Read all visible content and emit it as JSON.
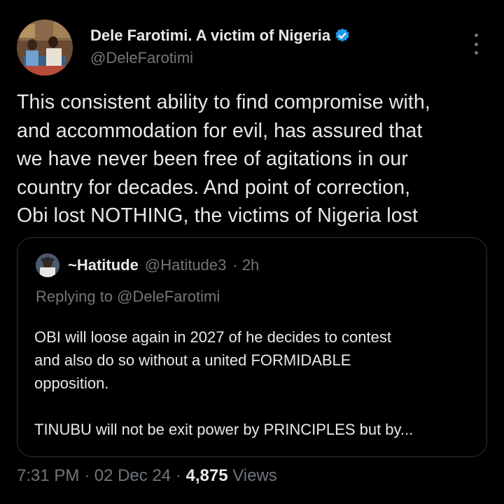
{
  "author": {
    "display_name": "Dele Farotimi. A victim of Nigeria",
    "handle": "@DeleFarotimi",
    "verified_color": "#1d9bf0"
  },
  "tweet": {
    "text_lines": [
      "This consistent ability to find compromise with,",
      "and accommodation for evil, has assured that",
      "we have never been free of agitations in our",
      "country for decades. And point of correction,",
      "Obi lost NOTHING, the victims of Nigeria lost"
    ]
  },
  "quote": {
    "display_name": "~Hatitude",
    "handle": "@Hatitude3",
    "time": "· 2h",
    "replying_to": "Replying to @DeleFarotimi",
    "para1_lines": [
      "OBI will loose again in 2027 of he decides to contest",
      "and also do so without a united FORMIDABLE",
      "opposition."
    ],
    "para2": "TINUBU will not be exit power by PRINCIPLES but by..."
  },
  "footer": {
    "time": "7:31 PM",
    "separator": "·",
    "date": "02 Dec 24",
    "views_count": "4,875",
    "views_label": "Views"
  },
  "icons": {
    "verified": "verified-badge-icon",
    "more": "more-options-icon"
  }
}
